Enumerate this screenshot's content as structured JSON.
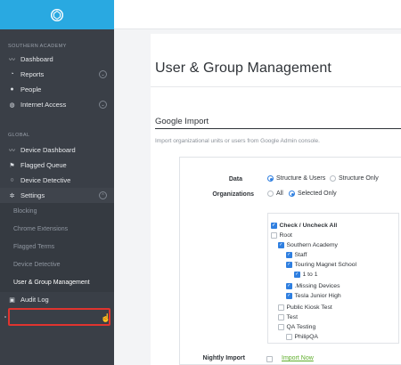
{
  "sidebar": {
    "section1": "SOUTHERN ACADEMY",
    "items1": [
      {
        "label": "Dashboard",
        "icon": "activity-icon"
      },
      {
        "label": "Reports",
        "icon": "pie-chart-icon"
      },
      {
        "label": "People",
        "icon": "user-icon"
      },
      {
        "label": "Internet Access",
        "icon": "globe-icon"
      }
    ],
    "section2": "GLOBAL",
    "items2": [
      {
        "label": "Device Dashboard",
        "icon": "activity-icon"
      },
      {
        "label": "Flagged Queue",
        "icon": "flag-icon"
      },
      {
        "label": "Device Detective",
        "icon": "search-icon"
      },
      {
        "label": "Settings",
        "icon": "gear-icon"
      }
    ],
    "settings_sub": [
      "Blocking",
      "Chrome Extensions",
      "Flagged Terms",
      "Device Detective",
      "User & Group Management"
    ],
    "audit_log": "Audit Log"
  },
  "main": {
    "title": "User & Group Management",
    "section": "Google Import",
    "description": "Import organizational units or users from Google Admin console.",
    "data_label": "Data",
    "data_options": [
      "Structure & Users",
      "Structure Only"
    ],
    "org_label": "Organizations",
    "org_options": [
      "All",
      "Selected Only"
    ],
    "tree": [
      "Check / Uncheck All",
      "Root",
      "Southern Academy",
      "Staff",
      "Touring Magnet School",
      "1 to 1",
      ".Missing Devices",
      "Tesla Junior High",
      "Public Kiosk Test",
      "Test",
      "QA Testing",
      "PhilipQA"
    ],
    "nightly_label": "Nightly Import",
    "import_now": "Import Now"
  },
  "colors": {
    "accent": "#2f7fe0",
    "brand": "#29a9e1",
    "sidebar": "#3a3f47",
    "highlight": "#e0342f",
    "link": "#5fae2c"
  }
}
